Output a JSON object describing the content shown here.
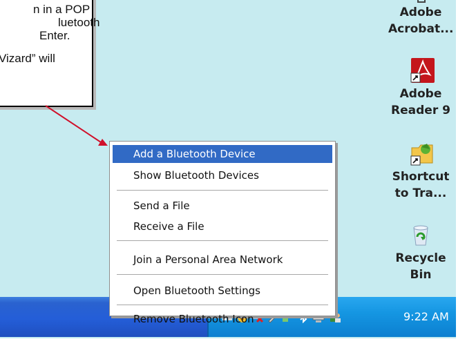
{
  "callout": {
    "lines": [
      "n in a POP",
      "luetooth",
      "Enter.",
      "",
      "Vizard” will"
    ]
  },
  "desktop_icons": [
    {
      "name": "adobe-acrobat",
      "label_lines": [
        "Adobe",
        "Acrobat..."
      ]
    },
    {
      "name": "adobe-reader",
      "label_lines": [
        "Adobe",
        "Reader 9"
      ]
    },
    {
      "name": "shortcut-tra",
      "label_lines": [
        "Shortcut",
        "to Tra..."
      ]
    },
    {
      "name": "recycle-bin",
      "label_lines": [
        "Recycle",
        "Bin"
      ]
    }
  ],
  "context_menu": {
    "items": [
      "Add a Bluetooth Device",
      "Show Bluetooth Devices",
      "Send a File",
      "Receive a File",
      "Join a Personal Area Network",
      "Open Bluetooth Settings",
      "Remove Bluetooth Icon"
    ],
    "highlighted": "Add a Bluetooth Device"
  },
  "taskbar": {
    "clock": "9:22 AM"
  },
  "colors": {
    "desktop": "#c7ebf0",
    "menu_highlight": "#316ac5",
    "arrow": "#d0102a"
  }
}
